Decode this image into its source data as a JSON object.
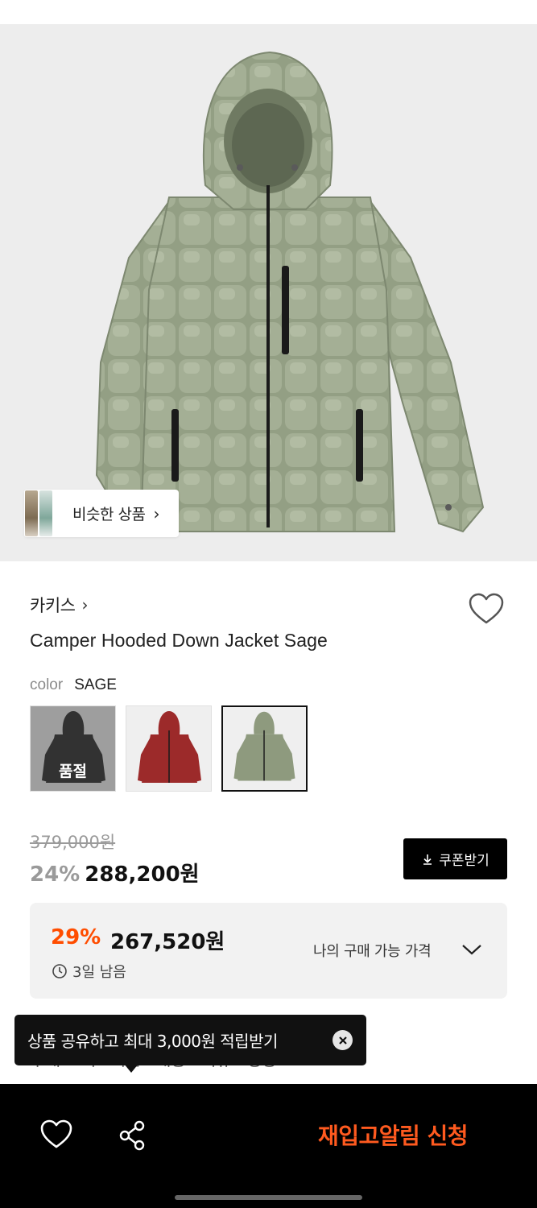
{
  "similar": {
    "label": "비슷한 상품",
    "chevron": "›"
  },
  "brand": {
    "name": "카키스",
    "chevron": "›"
  },
  "product": {
    "name": "Camper Hooded Down Jacket Sage"
  },
  "color": {
    "key": "color",
    "value": "SAGE"
  },
  "swatches": [
    {
      "name": "black",
      "color": "#2b2b2b",
      "soldout": true,
      "soldout_label": "품절"
    },
    {
      "name": "red",
      "color": "#9c2a2a",
      "soldout": false
    },
    {
      "name": "sage",
      "color": "#8e9a7e",
      "soldout": false,
      "selected": true
    }
  ],
  "price": {
    "original": "379,000원",
    "discount": "24%",
    "sale": "288,200원"
  },
  "coupon": {
    "label": "쿠폰받기",
    "icon": "download-icon"
  },
  "my_price": {
    "discount": "29%",
    "price": "267,520원",
    "timer": "3일 남음",
    "label": "나의 구매 가능 가격"
  },
  "toast": {
    "message": "상품 공유하고 최대 3,000원 적립받기"
  },
  "partial_line": "구매 고객 · 적립 · 배송 · 리뷰 · 랭킹",
  "bottom": {
    "cta": "재입고알림 신청"
  },
  "colors": {
    "accent": "#ff4d00",
    "cta": "#ff5a1f",
    "hero_bg": "#ededed",
    "jacket": "#8e9a7e"
  }
}
